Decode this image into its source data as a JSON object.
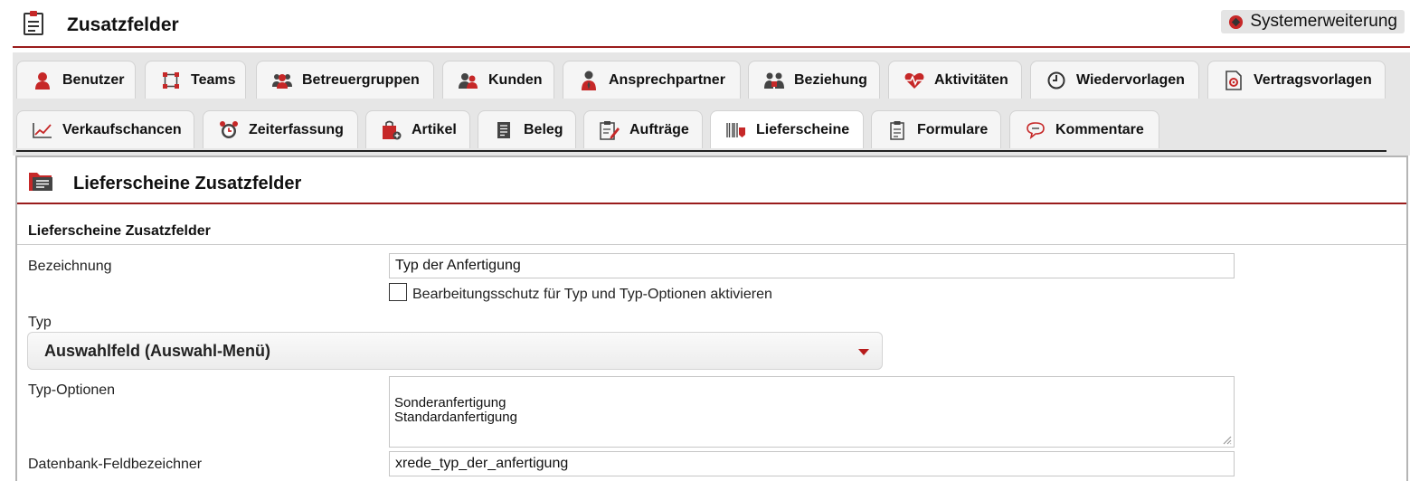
{
  "header": {
    "title": "Zusatzfelder",
    "system_button": "Systemerweiterung"
  },
  "tabs_row1": [
    {
      "label": "Benutzer",
      "icon": "user-icon"
    },
    {
      "label": "Teams",
      "icon": "team-nodes-icon"
    },
    {
      "label": "Betreuergruppen",
      "icon": "group-icon"
    },
    {
      "label": "Kunden",
      "icon": "customers-icon"
    },
    {
      "label": "Ansprechpartner",
      "icon": "contact-person-icon"
    },
    {
      "label": "Beziehung",
      "icon": "relationship-icon"
    },
    {
      "label": "Aktivitäten",
      "icon": "heart-pulse-icon"
    },
    {
      "label": "Wiedervorlagen",
      "icon": "clock-icon"
    },
    {
      "label": "Vertragsvorlagen",
      "icon": "contract-document-icon"
    }
  ],
  "tabs_row2": [
    {
      "label": "Verkaufschancen",
      "icon": "line-chart-icon"
    },
    {
      "label": "Zeiterfassung",
      "icon": "alarm-clock-icon"
    },
    {
      "label": "Artikel",
      "icon": "shopping-bag-icon"
    },
    {
      "label": "Beleg",
      "icon": "document-icon"
    },
    {
      "label": "Aufträge",
      "icon": "clipboard-edit-icon"
    },
    {
      "label": "Lieferscheine",
      "icon": "barcode-icon"
    },
    {
      "label": "Formulare",
      "icon": "form-icon"
    },
    {
      "label": "Kommentare",
      "icon": "comments-icon"
    }
  ],
  "active_tab": "Lieferscheine",
  "panel": {
    "title": "Lieferscheine Zusatzfelder",
    "section_title": "Lieferscheine Zusatzfelder",
    "fields": {
      "bezeichnung_label": "Bezeichnung",
      "bezeichnung_value": "Typ der Anfertigung",
      "protect_label": "Bearbeitungsschutz für Typ und Typ-Optionen aktivieren",
      "protect_checked": false,
      "typ_label": "Typ",
      "typ_value": "Auswahlfeld (Auswahl-Menü)",
      "typ_options_label": "Typ-Optionen",
      "typ_options_value": "Sonderanfertigung\nStandardanfertigung",
      "db_label": "Datenbank-Feldbezeichner",
      "db_value": "xrede_typ_der_anfertigung"
    }
  },
  "colors": {
    "accent": "#9a1c1c",
    "icon_red": "#c62828",
    "icon_dark": "#444444",
    "tab_bg": "#f5f5f5",
    "tab_area": "#e6e6e6"
  }
}
